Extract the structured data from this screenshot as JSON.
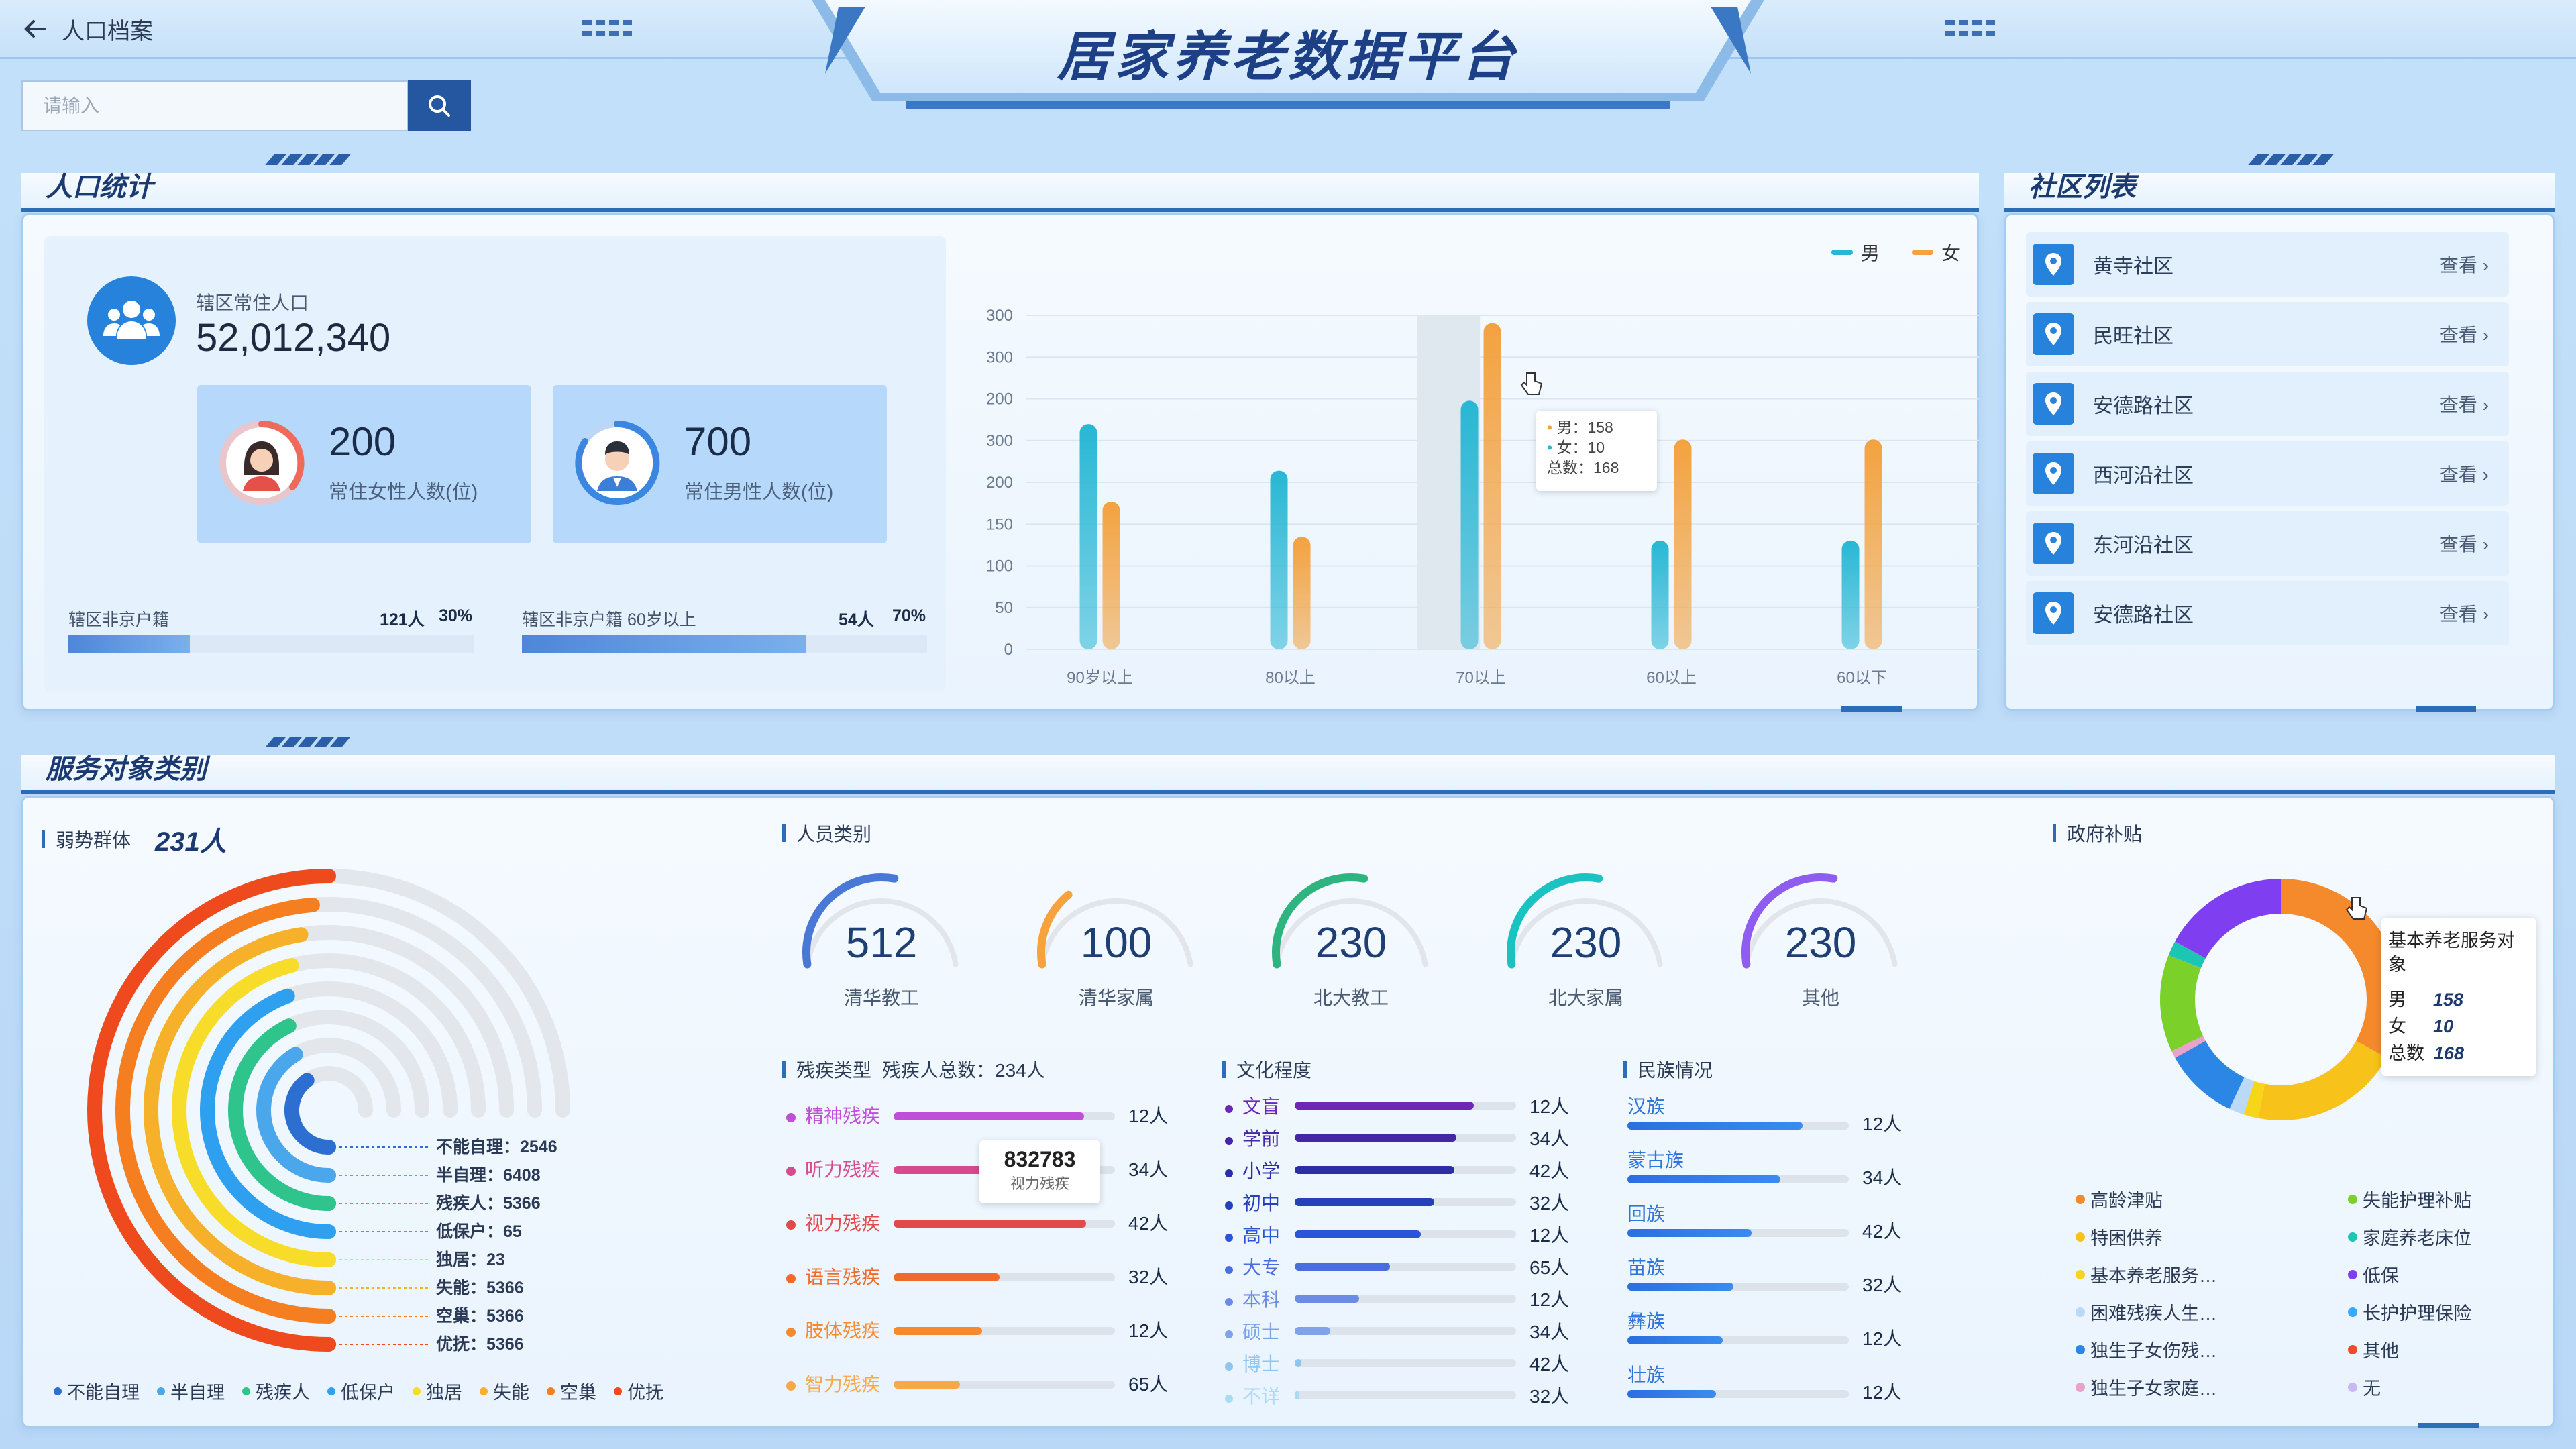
{
  "header": {
    "back_label": "人口档案",
    "title": "居家养老数据平台"
  },
  "search": {
    "placeholder": "请输入"
  },
  "population": {
    "section_title": "人口统计",
    "resident_label": "辖区常住人口",
    "resident_value": "52,012,340",
    "female": {
      "value": "200",
      "caption": "常住女性人数(位)"
    },
    "male": {
      "value": "700",
      "caption": "常住男性人数(位)"
    },
    "progress": [
      {
        "label": "辖区非京户籍",
        "count": "121人",
        "percent": "30%",
        "fraction": 0.3
      },
      {
        "label": "辖区非京户籍 60岁以上",
        "count": "54人",
        "percent": "70%",
        "fraction": 0.7
      }
    ]
  },
  "chart_data": {
    "type": "bar",
    "categories": [
      "90岁以上",
      "80以上",
      "70以上",
      "60以上",
      "60以下"
    ],
    "series": [
      {
        "name": "男",
        "values": [
          290,
          230,
          320,
          140,
          140
        ],
        "color": "#27b7d4"
      },
      {
        "name": "女",
        "values": [
          190,
          145,
          420,
          270,
          270
        ],
        "color": "#f3a23f"
      }
    ],
    "yticks": [
      "0",
      "50",
      "100",
      "150",
      "200",
      "300",
      "200",
      "300",
      "300"
    ],
    "ylim": [
      0,
      430
    ],
    "legend_position": "top-right",
    "tooltip": {
      "male": "男：158",
      "female": "女：10",
      "total": "总数：168"
    }
  },
  "community": {
    "section_title": "社区列表",
    "view_label": "查看",
    "items": [
      "黄寺社区",
      "民旺社区",
      "安德路社区",
      "西河沿社区",
      "东河沿社区",
      "安德路社区"
    ]
  },
  "service": {
    "section_title": "服务对象类别",
    "vulnerable": {
      "title": "弱势群体",
      "total": "231人",
      "rings": [
        {
          "label": "不能自理",
          "value": "2546",
          "color": "#2c6fd1",
          "fraction": 0.6
        },
        {
          "label": "半自理",
          "value": "6408",
          "color": "#4aa7ec",
          "fraction": 0.66
        },
        {
          "label": "残疾人",
          "value": "5366",
          "color": "#2fc48c",
          "fraction": 0.72
        },
        {
          "label": "低保户",
          "value": "65",
          "color": "#2fa0f0",
          "fraction": 0.78
        },
        {
          "label": "独居",
          "value": "23",
          "color": "#f7dc2a",
          "fraction": 0.84
        },
        {
          "label": "失能",
          "value": "5366",
          "color": "#f7b02a",
          "fraction": 0.9
        },
        {
          "label": "空巢",
          "value": "5366",
          "color": "#f57f20",
          "fraction": 0.95
        },
        {
          "label": "优抚",
          "value": "5366",
          "color": "#ef4a1d",
          "fraction": 1.0
        }
      ]
    },
    "personnel": {
      "title": "人员类别",
      "gauges": [
        {
          "value": "512",
          "label": "清华教工",
          "color": "#4a78d6",
          "fraction": 0.55
        },
        {
          "value": "100",
          "label": "清华家属",
          "color": "#f7a23a",
          "fraction": 0.3
        },
        {
          "value": "230",
          "label": "北大教工",
          "color": "#2fb37f",
          "fraction": 0.55
        },
        {
          "value": "230",
          "label": "北大家属",
          "color": "#1bc2c2",
          "fraction": 0.55
        },
        {
          "value": "230",
          "label": "其他",
          "color": "#8f5cf0",
          "fraction": 0.55
        }
      ]
    },
    "disability": {
      "title": "残疾类型",
      "total_label": "残疾人总数：234人",
      "tooltip": {
        "value": "832783",
        "label": "视力残疾"
      },
      "rows": [
        {
          "label": "精神残疾",
          "value": "12人",
          "color": "#c04fd8",
          "fraction": 0.86
        },
        {
          "label": "听力残疾",
          "value": "34人",
          "color": "#d64a8e",
          "fraction": 0.78
        },
        {
          "label": "视力残疾",
          "value": "42人",
          "color": "#e04a4a",
          "fraction": 0.87
        },
        {
          "label": "语言残疾",
          "value": "32人",
          "color": "#f06a2c",
          "fraction": 0.48
        },
        {
          "label": "肢体残疾",
          "value": "12人",
          "color": "#f5892e",
          "fraction": 0.4
        },
        {
          "label": "智力残疾",
          "value": "65人",
          "color": "#f7a94a",
          "fraction": 0.3
        }
      ]
    },
    "education": {
      "title": "文化程度",
      "rows": [
        {
          "label": "文盲",
          "value": "12人",
          "color": "#6b27b8",
          "fraction": 0.81
        },
        {
          "label": "学前",
          "value": "34人",
          "color": "#4525a8",
          "fraction": 0.73
        },
        {
          "label": "小学",
          "value": "42人",
          "color": "#2b2ea8",
          "fraction": 0.72
        },
        {
          "label": "初中",
          "value": "32人",
          "color": "#2540b8",
          "fraction": 0.63
        },
        {
          "label": "高中",
          "value": "12人",
          "color": "#2b55d4",
          "fraction": 0.57
        },
        {
          "label": "大专",
          "value": "65人",
          "color": "#4a6ee0",
          "fraction": 0.43
        },
        {
          "label": "本科",
          "value": "12人",
          "color": "#6a8be6",
          "fraction": 0.29
        },
        {
          "label": "硕士",
          "value": "34人",
          "color": "#7fa3ea",
          "fraction": 0.16
        },
        {
          "label": "博士",
          "value": "42人",
          "color": "#8fc6f0",
          "fraction": 0.03
        },
        {
          "label": "不详",
          "value": "32人",
          "color": "#a8dcf5",
          "fraction": 0.02
        }
      ]
    },
    "ethnicity": {
      "title": "民族情况",
      "rows": [
        {
          "label": "汉族",
          "value": "12人",
          "fraction": 0.79
        },
        {
          "label": "蒙古族",
          "value": "34人",
          "fraction": 0.69
        },
        {
          "label": "回族",
          "value": "42人",
          "fraction": 0.56
        },
        {
          "label": "苗族",
          "value": "32人",
          "fraction": 0.48
        },
        {
          "label": "彝族",
          "value": "12人",
          "fraction": 0.43
        },
        {
          "label": "壮族",
          "value": "12人",
          "fraction": 0.4
        }
      ]
    },
    "subsidy": {
      "title": "政府补贴",
      "tooltip": {
        "title": "基本养老服务对象",
        "male_label": "男",
        "male_value": "158",
        "female_label": "女",
        "female_value": "10",
        "total_label": "总数",
        "total_value": "168"
      },
      "segments": [
        {
          "label": "高龄津贴",
          "color": "#f58a2c",
          "value": 33
        },
        {
          "label": "特困供养",
          "color": "#f7c21a",
          "value": 20
        },
        {
          "label": "基本养老服务…",
          "color": "#f7d61a",
          "value": 2
        },
        {
          "label": "困难残疾人生…",
          "color": "#b9d9f5",
          "value": 2
        },
        {
          "label": "独生子女伤残…",
          "color": "#2c86e6",
          "value": 10
        },
        {
          "label": "独生子女家庭…",
          "color": "#e9a2c9",
          "value": 1
        },
        {
          "label": "失能护理补贴",
          "color": "#7bd12a",
          "value": 13
        },
        {
          "label": "家庭养老床位",
          "color": "#1cc6b4",
          "value": 2
        },
        {
          "label": "低保",
          "color": "#7f3ff0",
          "value": 17
        },
        {
          "label": "长护护理保险",
          "color": "#3aa8ff",
          "value": 0
        },
        {
          "label": "其他",
          "color": "#ef4a2d",
          "value": 0
        },
        {
          "label": "无",
          "color": "#c9b8f5",
          "value": 0
        }
      ]
    }
  }
}
